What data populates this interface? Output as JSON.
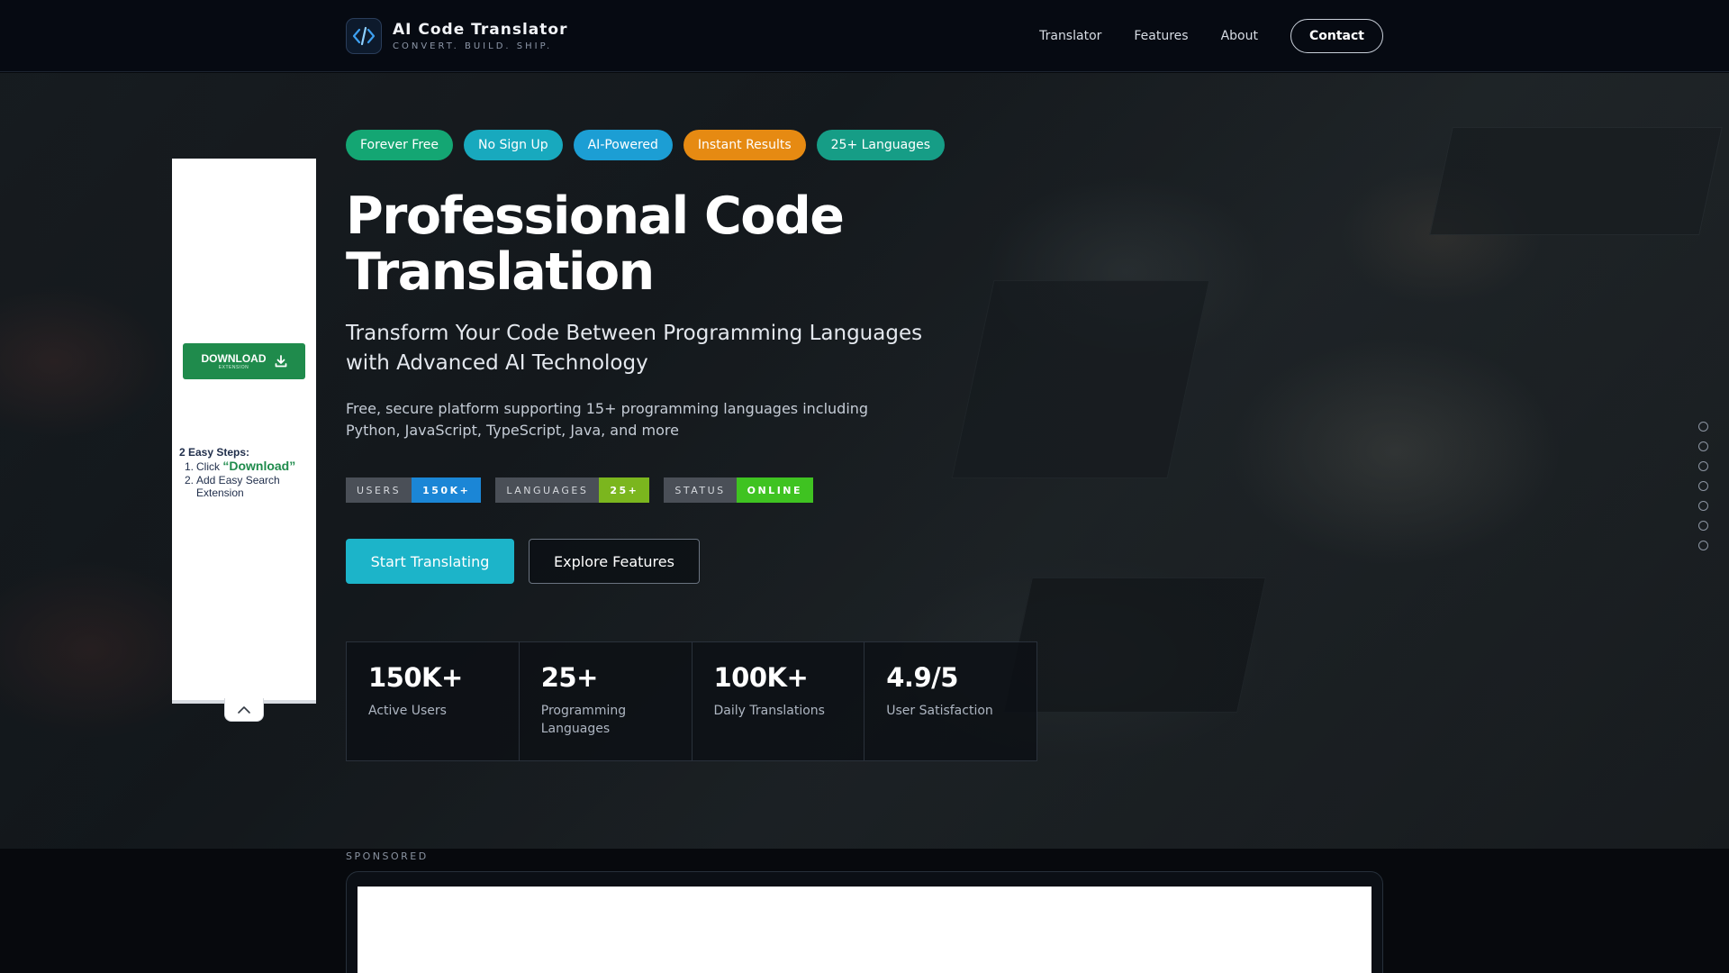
{
  "header": {
    "brand_name": "AI Code Translator",
    "brand_tagline": "CONVERT. BUILD. SHIP.",
    "nav": [
      {
        "label": "Translator"
      },
      {
        "label": "Features"
      },
      {
        "label": "About"
      }
    ],
    "contact_label": "Contact"
  },
  "hero": {
    "badges": [
      {
        "label": "Forever Free",
        "color": "#14a673"
      },
      {
        "label": "No Sign Up",
        "color": "#18a9be"
      },
      {
        "label": "AI-Powered",
        "color": "#1c9ed4"
      },
      {
        "label": "Instant Results",
        "color": "#e68a12"
      },
      {
        "label": "25+ Languages",
        "color": "#169d86"
      }
    ],
    "title": "Professional Code Translation",
    "subtitle": "Transform Your Code Between Programming Languages with Advanced AI Technology",
    "description": "Free, secure platform supporting 15+ programming languages including Python, JavaScript, TypeScript, Java, and more",
    "shields": [
      {
        "key": "USERS",
        "value": "150K+",
        "color": "#1b86d6"
      },
      {
        "key": "LANGUAGES",
        "value": "25+",
        "color": "#7bb61e"
      },
      {
        "key": "STATUS",
        "value": "ONLINE",
        "color": "#3fc321"
      }
    ],
    "cta_primary": "Start Translating",
    "cta_secondary": "Explore Features",
    "stats": [
      {
        "value": "150K+",
        "label": "Active Users"
      },
      {
        "value": "25+",
        "label": "Programming Languages"
      },
      {
        "value": "100K+",
        "label": "Daily Translations"
      },
      {
        "value": "4.9/5",
        "label": "User Satisfaction"
      }
    ]
  },
  "ad": {
    "download_label": "DOWNLOAD",
    "download_sub": "EXTENSION",
    "steps_title": "2 Easy Steps:",
    "step1_prefix": "Click ",
    "step1_highlight": "“Download”",
    "step2_line1": "Add Easy Search",
    "step2_line2": "Extension"
  },
  "sponsored": {
    "label": "SPONSORED"
  },
  "colors": {
    "accent": "#1cb4c9",
    "header_bg": "#060a12",
    "ad_green": "#1f8b4c"
  },
  "icons": {
    "brand": "code-brackets-icon",
    "download": "download-arrow-icon",
    "collapse": "chevron-up-icon"
  }
}
